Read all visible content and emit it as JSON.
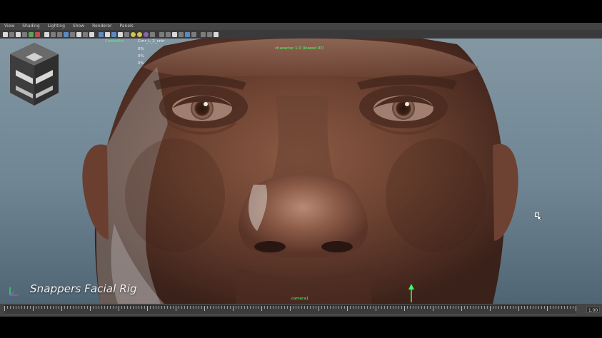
{
  "menu": [
    "View",
    "Shading",
    "Lighting",
    "Show",
    "Renderer",
    "Panels"
  ],
  "toolbar_icons": [
    "select-tool-icon",
    "lasso-tool-icon",
    "paint-tool-icon",
    "move-tool-icon",
    "rotate-tool-icon",
    "scale-tool-icon",
    "manipulator-icon",
    "soft-mod-icon",
    "camera-icon",
    "grid-icon",
    "film-gate-icon",
    "resolution-gate-icon",
    "safe-action-icon",
    "field-chart-icon",
    "wireframe-icon",
    "smooth-shade-icon",
    "bounding-box-icon",
    "textured-icon",
    "lights-icon",
    "shadows-icon",
    "xray-icon",
    "isolate-icon",
    "aa-icon",
    "ssao-icon",
    "motion-blur-icon",
    "dof-icon",
    "hud-icon"
  ],
  "hud": {
    "label_controller": "Controller",
    "label_ctrl_name": "Crnr_L_2_cntr",
    "label_mid_top": "character 1.0 (lowest ID)",
    "label_bottom": "camera1",
    "side_values": [
      "0%",
      "0%",
      "0%"
    ]
  },
  "caption": {
    "title": "Snappers Facial Rig"
  },
  "timeline": {
    "current_frame": "1.00"
  },
  "colors": {
    "hud_green": "#4cff6a",
    "viewport_top": "#8397a3",
    "viewport_bottom": "#4f6573"
  }
}
